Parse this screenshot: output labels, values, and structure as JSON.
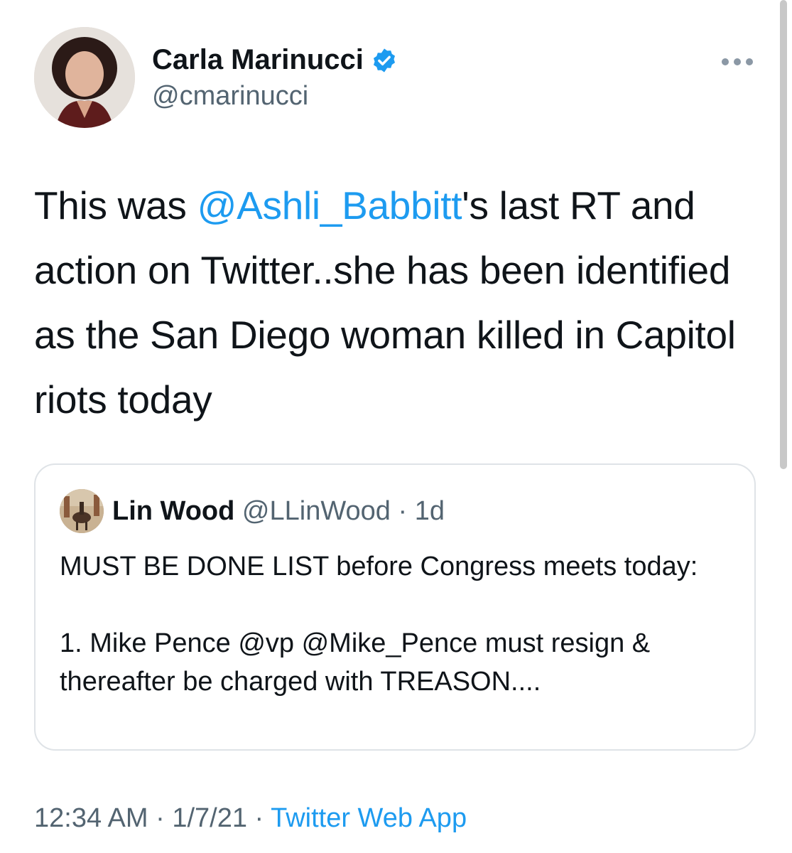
{
  "author": {
    "display_name": "Carla Marinucci",
    "handle": "@cmarinucci",
    "avatar_icon": "profile-photo-woman",
    "verified_icon": "verified-badge-icon"
  },
  "tweet": {
    "text_before": "This was ",
    "mention": "@Ashli_Babbitt",
    "text_after": "'s last RT and action on Twitter..she has been identified as the San Diego woman killed in Capitol riots today"
  },
  "quoted_tweet": {
    "display_name": "Lin Wood",
    "handle": "@LLinWood",
    "separator": " · ",
    "age": "1d",
    "text": "MUST BE DONE LIST before Congress meets today:\n\n1. Mike Pence @vp @Mike_Pence must resign & thereafter be charged with TREASON...."
  },
  "footer": {
    "time": "12:34 AM",
    "sep1": " · ",
    "date": "1/7/21",
    "sep2": " · ",
    "source": "Twitter Web App"
  },
  "colors": {
    "link": "#1d9bf0",
    "secondary_text": "#536471",
    "border": "#dfe3e7"
  }
}
